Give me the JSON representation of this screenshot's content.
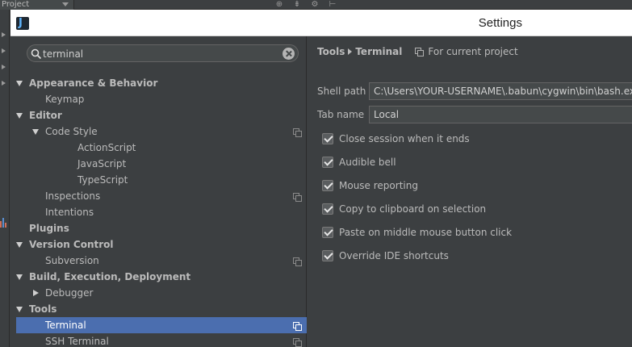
{
  "ide": {
    "project_selector": "Project"
  },
  "window": {
    "title": "Settings"
  },
  "search": {
    "value": "terminal"
  },
  "tree": [
    {
      "label": "Appearance & Behavior",
      "indent": 0,
      "bold": true,
      "caret": "down",
      "copy": false,
      "selected": false
    },
    {
      "label": "Keymap",
      "indent": 1,
      "bold": false,
      "caret": "none",
      "copy": false,
      "selected": false
    },
    {
      "label": "Editor",
      "indent": 0,
      "bold": true,
      "caret": "down",
      "copy": false,
      "selected": false
    },
    {
      "label": "Code Style",
      "indent": 1,
      "bold": false,
      "caret": "down",
      "copy": true,
      "selected": false
    },
    {
      "label": "ActionScript",
      "indent": 2,
      "bold": false,
      "caret": "none",
      "copy": false,
      "selected": false
    },
    {
      "label": "JavaScript",
      "indent": 2,
      "bold": false,
      "caret": "none",
      "copy": false,
      "selected": false
    },
    {
      "label": "TypeScript",
      "indent": 2,
      "bold": false,
      "caret": "none",
      "copy": false,
      "selected": false
    },
    {
      "label": "Inspections",
      "indent": 1,
      "bold": false,
      "caret": "none",
      "copy": true,
      "selected": false
    },
    {
      "label": "Intentions",
      "indent": 1,
      "bold": false,
      "caret": "none",
      "copy": false,
      "selected": false
    },
    {
      "label": "Plugins",
      "indent": 0,
      "bold": true,
      "caret": "none",
      "copy": false,
      "selected": false
    },
    {
      "label": "Version Control",
      "indent": 0,
      "bold": true,
      "caret": "down",
      "copy": false,
      "selected": false
    },
    {
      "label": "Subversion",
      "indent": 1,
      "bold": false,
      "caret": "none",
      "copy": true,
      "selected": false
    },
    {
      "label": "Build, Execution, Deployment",
      "indent": 0,
      "bold": true,
      "caret": "down",
      "copy": false,
      "selected": false
    },
    {
      "label": "Debugger",
      "indent": 1,
      "bold": false,
      "caret": "right",
      "copy": false,
      "selected": false
    },
    {
      "label": "Tools",
      "indent": 0,
      "bold": true,
      "caret": "down",
      "copy": false,
      "selected": false
    },
    {
      "label": "Terminal",
      "indent": 1,
      "bold": false,
      "caret": "none",
      "copy": true,
      "selected": true
    },
    {
      "label": "SSH Terminal",
      "indent": 1,
      "bold": false,
      "caret": "none",
      "copy": true,
      "selected": false
    }
  ],
  "breadcrumb": {
    "parent": "Tools",
    "current": "Terminal",
    "scope": "For current project"
  },
  "fields": {
    "shell_path_label": "Shell path",
    "shell_path_value": "C:\\Users\\YOUR-USERNAME\\.babun\\cygwin\\bin\\bash.exe",
    "tab_name_label": "Tab name",
    "tab_name_value": "Local"
  },
  "checkboxes": [
    {
      "label": "Close session when it ends",
      "checked": true
    },
    {
      "label": "Audible bell",
      "checked": true
    },
    {
      "label": "Mouse reporting",
      "checked": true
    },
    {
      "label": "Copy to clipboard on selection",
      "checked": true
    },
    {
      "label": "Paste on middle mouse button click",
      "checked": true
    },
    {
      "label": "Override IDE shortcuts",
      "checked": true
    }
  ],
  "colors": {
    "background": "#3c3f41",
    "selection": "#4b6eaf",
    "text": "#bbbbbb",
    "titlebar": "#ffffff"
  }
}
